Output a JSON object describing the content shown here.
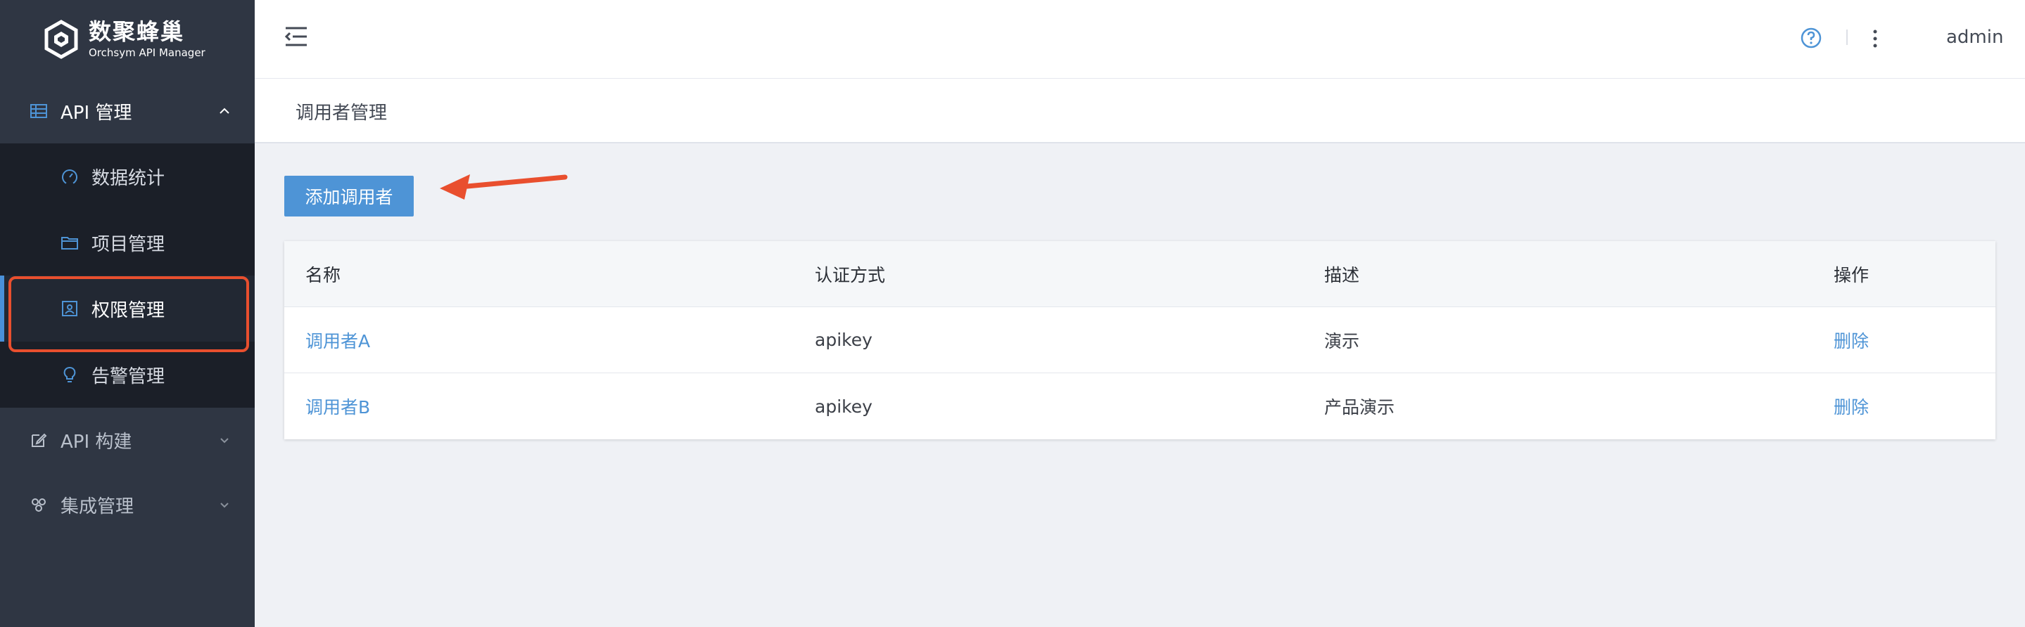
{
  "logo": {
    "title": "数聚蜂巢",
    "subtitle": "Orchsym API Manager"
  },
  "sidebar": {
    "groups": [
      {
        "label": "API 管理",
        "icon": "table-icon",
        "expanded": true,
        "items": [
          {
            "label": "数据统计",
            "icon": "gauge-icon"
          },
          {
            "label": "项目管理",
            "icon": "folder-icon"
          },
          {
            "label": "权限管理",
            "icon": "contact-card-icon",
            "active": true
          },
          {
            "label": "告警管理",
            "icon": "bulb-icon"
          }
        ]
      },
      {
        "label": "API 构建",
        "icon": "edit-icon",
        "expanded": false
      },
      {
        "label": "集成管理",
        "icon": "cluster-icon",
        "expanded": false
      }
    ]
  },
  "header": {
    "user": "admin"
  },
  "breadcrumb": "调用者管理",
  "actions": {
    "add_label": "添加调用者"
  },
  "table": {
    "columns": [
      "名称",
      "认证方式",
      "描述",
      "操作"
    ],
    "rows": [
      {
        "name": "调用者A",
        "auth": "apikey",
        "desc": "演示",
        "action": "删除"
      },
      {
        "name": "调用者B",
        "auth": "apikey",
        "desc": "产品演示",
        "action": "删除"
      }
    ]
  },
  "colors": {
    "sidebar_bg": "#2f3643",
    "submenu_bg": "#1b1f28",
    "accent": "#4e94d6",
    "highlight": "#e94f2e"
  }
}
